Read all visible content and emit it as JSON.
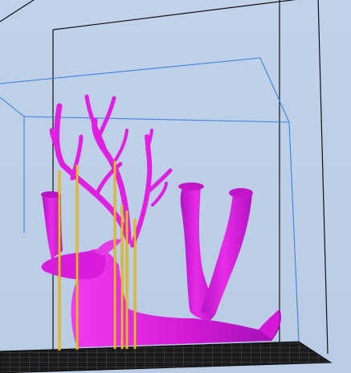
{
  "viewport": {
    "background_top": "#c0d2e9",
    "background_bottom": "#b9cce4",
    "model_color": "#e21fe0",
    "model_shadow_color": "#a010b4",
    "support_color": "#f2c418",
    "build_volume_color": "#111111",
    "model_bounding_box_color": "#3b82e6",
    "build_plate_color": "#161616",
    "support_count": 6,
    "model_name": "deer"
  }
}
